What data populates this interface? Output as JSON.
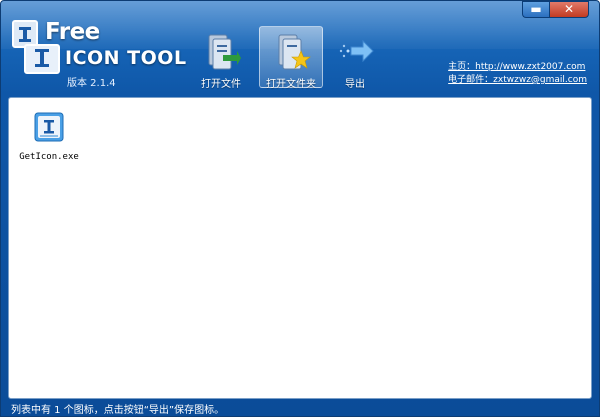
{
  "window": {
    "controls": {
      "minimize": "▬",
      "close": "✕"
    },
    "colors": {
      "frame": "#1766b8",
      "accent": "#2b78c8",
      "content_bg": "#ffffff",
      "close_button": "#c23b22"
    }
  },
  "logo": {
    "free": "Free",
    "tool": "ICON TOOL",
    "version": "版本 2.1.4"
  },
  "toolbar": {
    "open_file": {
      "label": "打开文件",
      "icon": "open-file-icon"
    },
    "open_folder": {
      "label": "打开文件夹",
      "icon": "open-folder-icon",
      "active": true
    },
    "export": {
      "label": "导出",
      "icon": "export-arrow-icon"
    }
  },
  "links": {
    "homepage": "主页：http://www.zxt2007.com",
    "email": "电子邮件：zxtwzwz@gmail.com"
  },
  "icon_list": {
    "items": [
      {
        "name": "GetIcon.exe",
        "icon": "app-icon"
      }
    ]
  },
  "statusbar": {
    "text": "列表中有 1 个图标，点击按钮“导出”保存图标。"
  }
}
